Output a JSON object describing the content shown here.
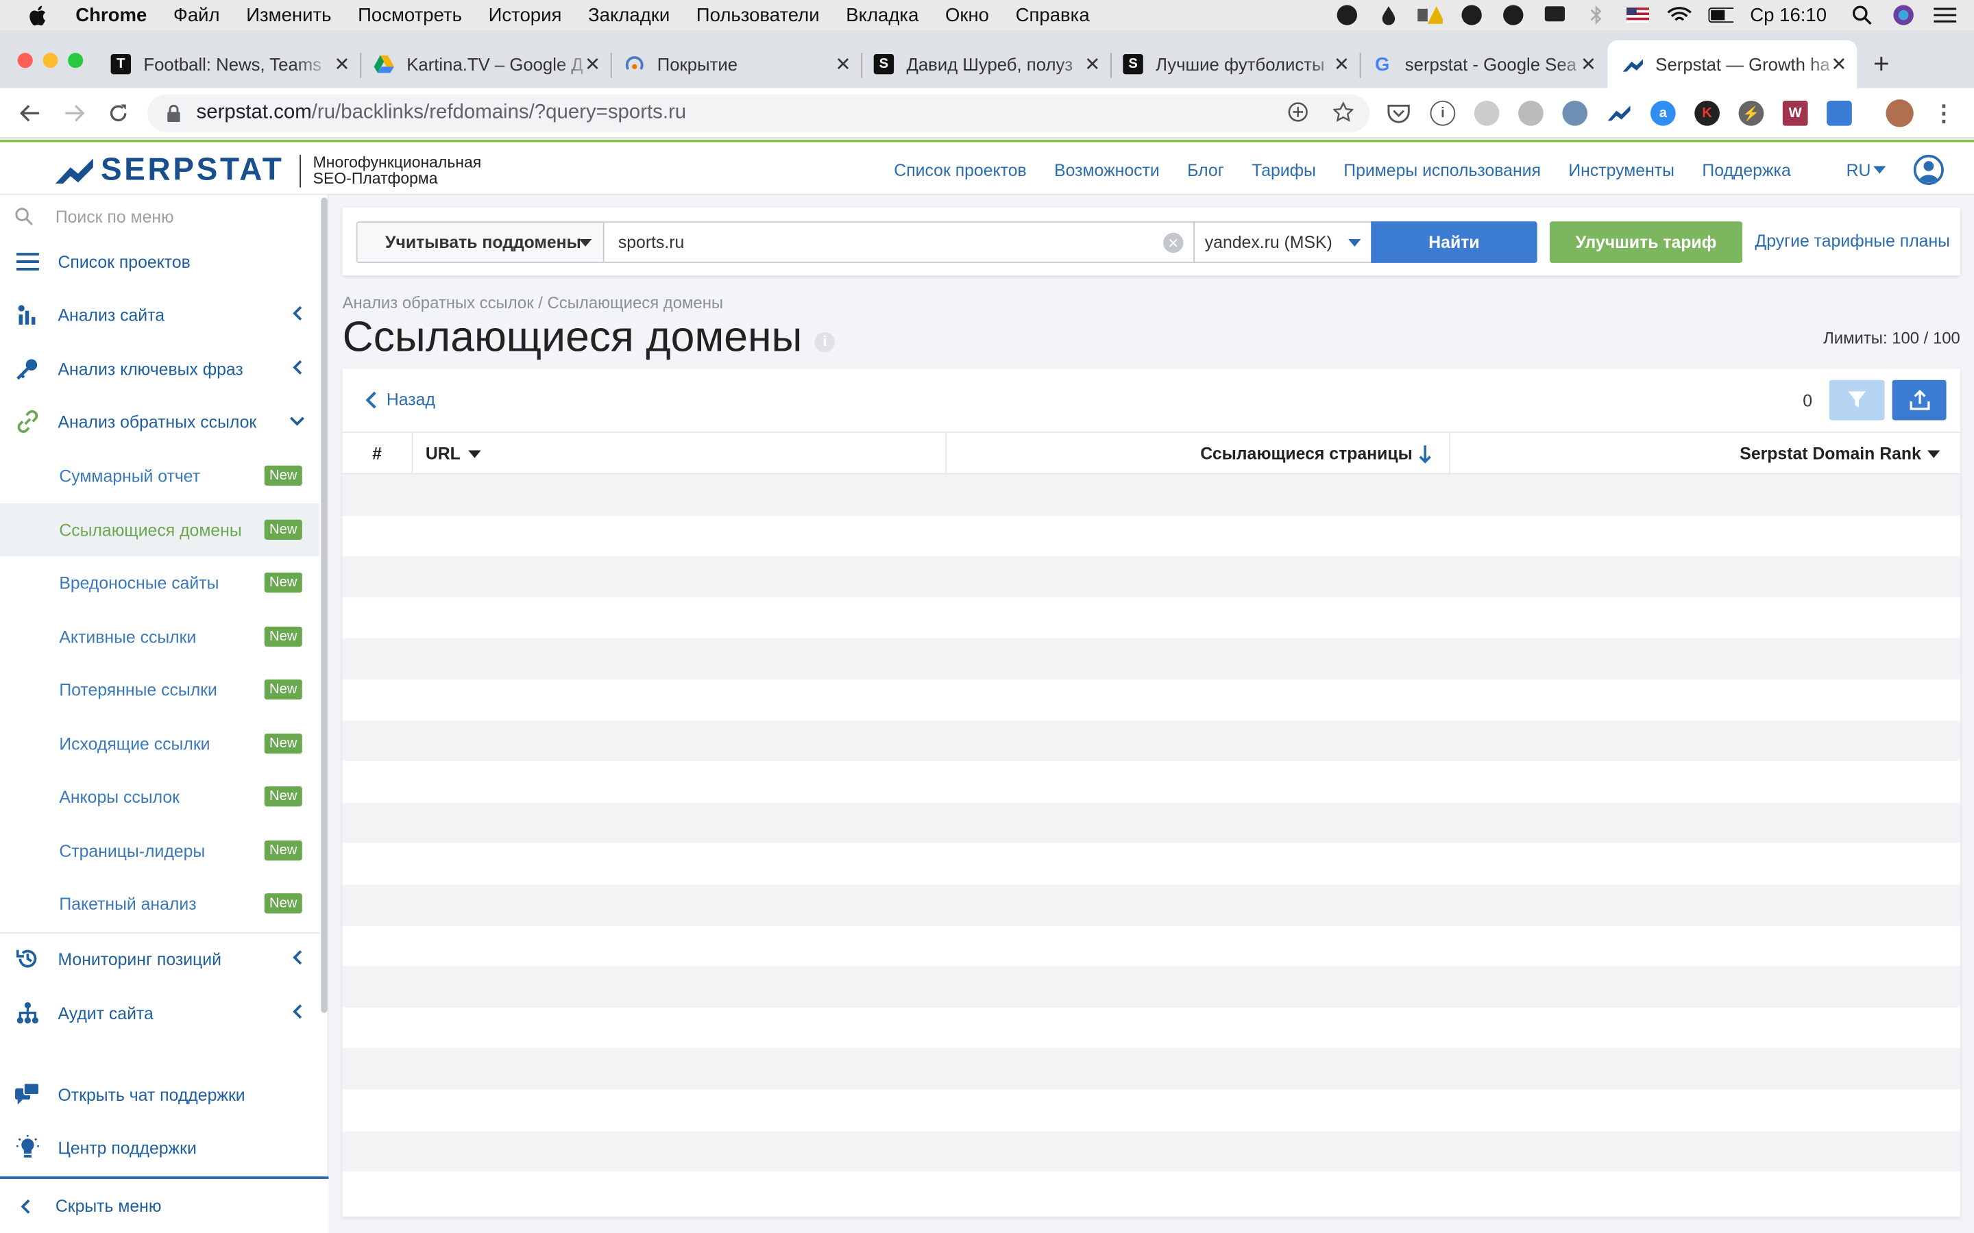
{
  "menubar": {
    "app": "Chrome",
    "items": [
      "Файл",
      "Изменить",
      "Посмотреть",
      "История",
      "Закладки",
      "Пользователи",
      "Вкладка",
      "Окно",
      "Справка"
    ],
    "clock": "Ср 16:10"
  },
  "tabs": [
    {
      "title": "Football: News, Teams",
      "fav": "T",
      "fav_color": "#111111"
    },
    {
      "title": "Kartina.TV – Google Д",
      "fav": "▲",
      "fav_color": "#f4b400"
    },
    {
      "title": "Покрытие",
      "fav": "◔",
      "fav_color": "#4a78c2"
    },
    {
      "title": "Давид Шуреб, полуз",
      "fav": "S",
      "fav_color": "#111111"
    },
    {
      "title": "Лучшие футболисты",
      "fav": "S",
      "fav_color": "#111111"
    },
    {
      "title": "serpstat - Google Sea",
      "fav": "G",
      "fav_color": "#4285f4"
    },
    {
      "title": "Serpstat — Growth ha",
      "fav": "◢",
      "fav_color": "#1a4f8f"
    }
  ],
  "address": {
    "host": "serpstat.com",
    "path": "/ru/backlinks/refdomains/?query=sports.ru"
  },
  "brand": {
    "name": "SERPSTAT",
    "tagline1": "Многофункциональная",
    "tagline2": "SEO-Платформа"
  },
  "topnav": [
    "Список проектов",
    "Возможности",
    "Блог",
    "Тарифы",
    "Примеры использования",
    "Инструменты",
    "Поддержка",
    "RU"
  ],
  "sidebar": {
    "search_placeholder": "Поиск по меню",
    "projects": "Список проектов",
    "sections": [
      {
        "label": "Анализ сайта",
        "icon": "site-analysis-icon"
      },
      {
        "label": "Анализ ключевых фраз",
        "icon": "key-icon"
      },
      {
        "label": "Анализ обратных ссылок",
        "icon": "link-icon"
      }
    ],
    "subitems": [
      {
        "label": "Суммарный отчет",
        "badge": "New"
      },
      {
        "label": "Ссылающиеся домены",
        "badge": "New"
      },
      {
        "label": "Вредоносные сайты",
        "badge": "New"
      },
      {
        "label": "Активные ссылки",
        "badge": "New"
      },
      {
        "label": "Потерянные ссылки",
        "badge": "New"
      },
      {
        "label": "Исходящие ссылки",
        "badge": "New"
      },
      {
        "label": "Анкоры ссылок",
        "badge": "New"
      },
      {
        "label": "Страницы-лидеры",
        "badge": "New"
      },
      {
        "label": "Пакетный анализ",
        "badge": "New"
      }
    ],
    "monitoring": "Мониторинг позиций",
    "audit": "Аудит сайта",
    "chat": "Открыть чат поддержки",
    "help": "Центр поддержки",
    "hide": "Скрыть меню"
  },
  "search": {
    "subdomains": "Учитывать поддомены",
    "query": "sports.ru",
    "engine": "yandex.ru (MSK)",
    "find": "Найти",
    "upgrade": "Улучшить тариф",
    "other_plans": "Другие тарифные планы"
  },
  "page": {
    "breadcrumb": "Анализ обратных ссылок / Ссылающиеся домены",
    "title": "Ссылающиеся домены",
    "limits": "Лимиты: 100 / 100",
    "back": "Назад",
    "filter_count": "0"
  },
  "table": {
    "columns": [
      "#",
      "URL",
      "Ссылающиеся страницы",
      "Serpstat Domain Rank"
    ]
  },
  "colors": {
    "accent": "#2b6cb0",
    "brand": "#1a4f8f",
    "green": "#6aa84f",
    "find_button": "#3b7bd1"
  }
}
